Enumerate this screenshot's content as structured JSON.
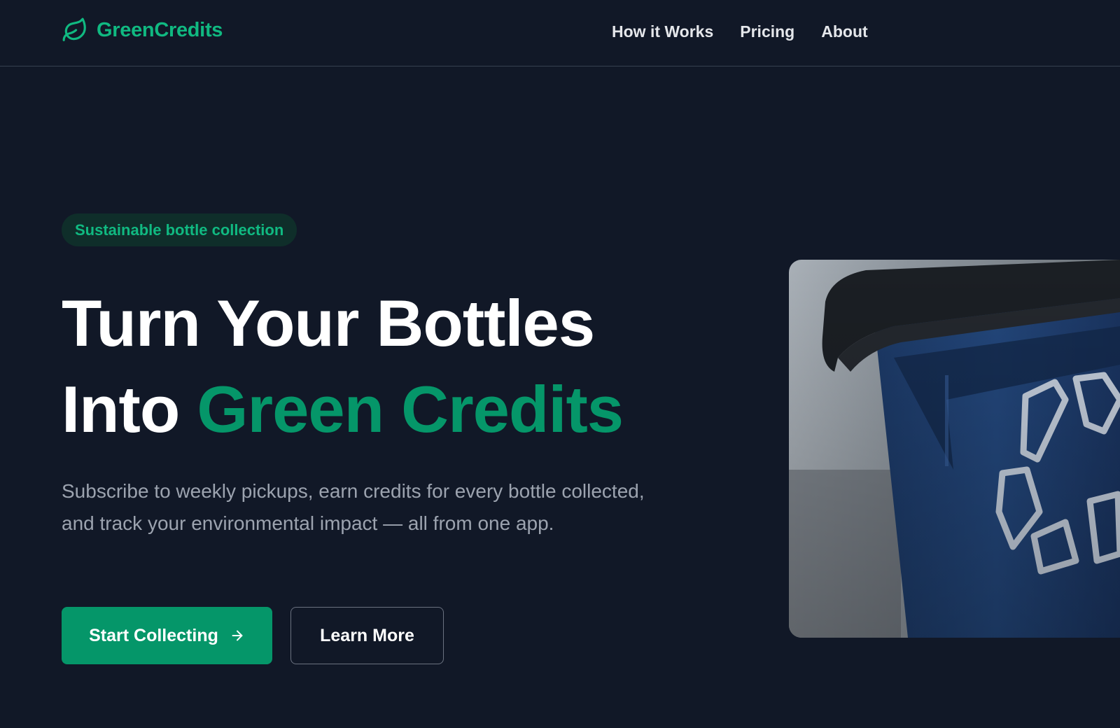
{
  "brand": {
    "name": "GreenCredits",
    "logo_icon": "leaf-icon",
    "color": "#10b981"
  },
  "nav": {
    "items": [
      {
        "label": "How it Works"
      },
      {
        "label": "Pricing"
      },
      {
        "label": "About"
      }
    ]
  },
  "hero": {
    "badge": "Sustainable bottle collection",
    "headline_line1": "Turn Your Bottles",
    "headline_line2_prefix": "Into",
    "headline_line2_accent": "Green Credits",
    "description": "Subscribe to weekly pickups, earn credits for every bottle collected, and track your environmental impact — all from one app.",
    "primary_cta": "Start Collecting",
    "primary_cta_icon": "arrow-right-icon",
    "secondary_cta": "Learn More",
    "image_subject": "blue recycling bin with recycle symbol"
  },
  "colors": {
    "background": "#111827",
    "accent": "#059669",
    "accent_light": "#10b981",
    "text_muted": "#9ca3af",
    "badge_bg": "#0f2e2a"
  }
}
